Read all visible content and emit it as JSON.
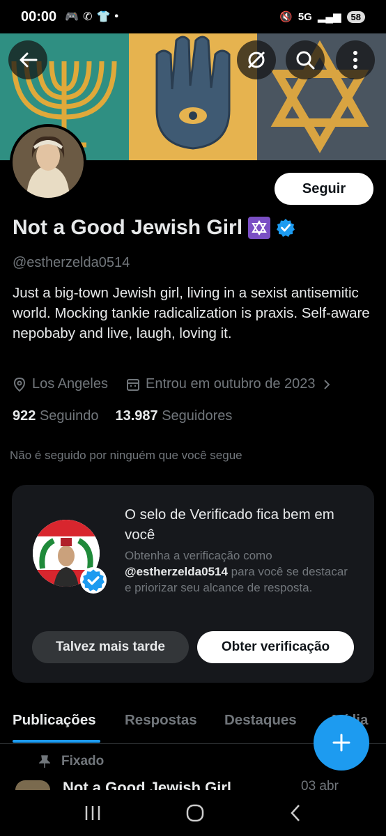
{
  "status_bar": {
    "time": "00:00",
    "network": "5G",
    "battery": "58"
  },
  "profile": {
    "name": "Not a Good Jewish Girl",
    "handle": "@estherzelda0514",
    "bio": "Just a big-town Jewish girl, living in a sexist antisemitic world. Mocking tankie radicalization is praxis. Self-aware nepobaby and live, laugh, loving it.",
    "location": "Los Angeles",
    "joined": "Entrou em outubro de 2023",
    "following_count": "922",
    "following_label": "Seguindo",
    "followers_count": "13.987",
    "followers_label": "Seguidores",
    "no_mutual": "Não é seguido por ninguém que você segue",
    "follow_button": "Seguir"
  },
  "verify_card": {
    "title": "O selo de Verificado fica bem em você",
    "text_before": "Obtenha a verificação como",
    "handle": "@estherzelda0514",
    "text_after": "para você se destacar e priorizar seu alcance de resposta.",
    "later_button": "Talvez mais tarde",
    "verify_button": "Obter verificação"
  },
  "tabs": [
    "Publicações",
    "Respostas",
    "Destaques",
    "Mídia"
  ],
  "pinned_label": "Fixado",
  "post_preview": {
    "author": "Not a Good Jewish Girl",
    "date": "03 abr"
  },
  "colors": {
    "accent": "#1d9bf0",
    "background": "#000000",
    "card": "#16181c"
  }
}
